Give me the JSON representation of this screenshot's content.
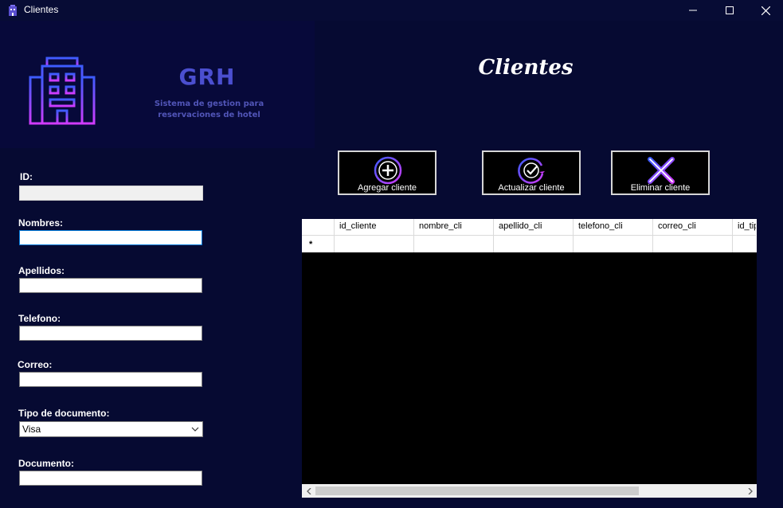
{
  "window": {
    "title": "Clientes"
  },
  "brand": {
    "name": "GRH",
    "subtitle": "Sistema de gestion para reservaciones de hotel"
  },
  "page": {
    "title": "Clientes"
  },
  "form": {
    "id": {
      "label": "ID:",
      "value": ""
    },
    "nombres": {
      "label": "Nombres:",
      "value": ""
    },
    "apellidos": {
      "label": "Apellidos:",
      "value": ""
    },
    "telefono": {
      "label": "Telefono:",
      "value": ""
    },
    "correo": {
      "label": "Correo:",
      "value": ""
    },
    "tipo_documento": {
      "label": "Tipo de documento:",
      "selected": "Visa"
    },
    "documento": {
      "label": "Documento:",
      "value": ""
    }
  },
  "actions": {
    "add": {
      "label": "Agregar cliente",
      "icon": "plus-circle-icon"
    },
    "update": {
      "label": "Actualizar cliente",
      "icon": "check-circle-icon"
    },
    "delete": {
      "label": "Eliminar cliente",
      "icon": "x-icon"
    }
  },
  "grid": {
    "columns": [
      "id_cliente",
      "nombre_cli",
      "apellido_cli",
      "telefono_cli",
      "correo_cli",
      "id_tip"
    ],
    "new_row_marker": "*"
  },
  "colors": {
    "background": "#060a32",
    "brand": "#4b4fd0",
    "icon_gradient_start": "#d13bff",
    "icon_gradient_end": "#3d5cff"
  }
}
